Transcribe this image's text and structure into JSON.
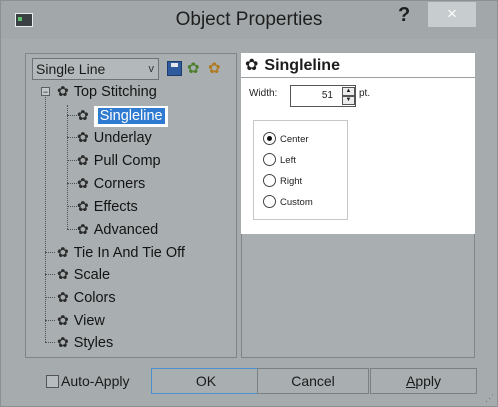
{
  "window": {
    "title": "Object Properties",
    "help": "?",
    "close": "×"
  },
  "toolbar": {
    "dropdown_value": "Single Line",
    "dropdown_chevron": "v",
    "icons": [
      "save-icon",
      "gear-green-icon",
      "gear-orange-icon"
    ]
  },
  "tree": {
    "expander": "−",
    "gear_glyph": "✿",
    "items": [
      {
        "label": "Top Stitching"
      },
      {
        "label": "Singleline"
      },
      {
        "label": "Underlay"
      },
      {
        "label": "Pull Comp"
      },
      {
        "label": "Corners"
      },
      {
        "label": "Effects"
      },
      {
        "label": "Advanced"
      },
      {
        "label": "Tie In And Tie Off"
      },
      {
        "label": "Scale"
      },
      {
        "label": "Colors"
      },
      {
        "label": "View"
      },
      {
        "label": "Styles"
      }
    ]
  },
  "detail": {
    "title": "Singleline",
    "width_label": "Width:",
    "width_value": "51",
    "spin_up": "▲",
    "spin_down": "▼",
    "unit": "pt.",
    "options": [
      {
        "label": "Center",
        "selected": true
      },
      {
        "label": "Left",
        "selected": false
      },
      {
        "label": "Right",
        "selected": false
      },
      {
        "label": "Custom",
        "selected": false
      }
    ]
  },
  "footer": {
    "auto_apply": "Auto-Apply",
    "ok": "OK",
    "cancel": "Cancel",
    "apply_underline": "A",
    "apply_rest": "pply"
  },
  "colors": {
    "selection": "#2e7bd1",
    "chrome": "#a6acae",
    "detail_bg": "#ffffff"
  }
}
